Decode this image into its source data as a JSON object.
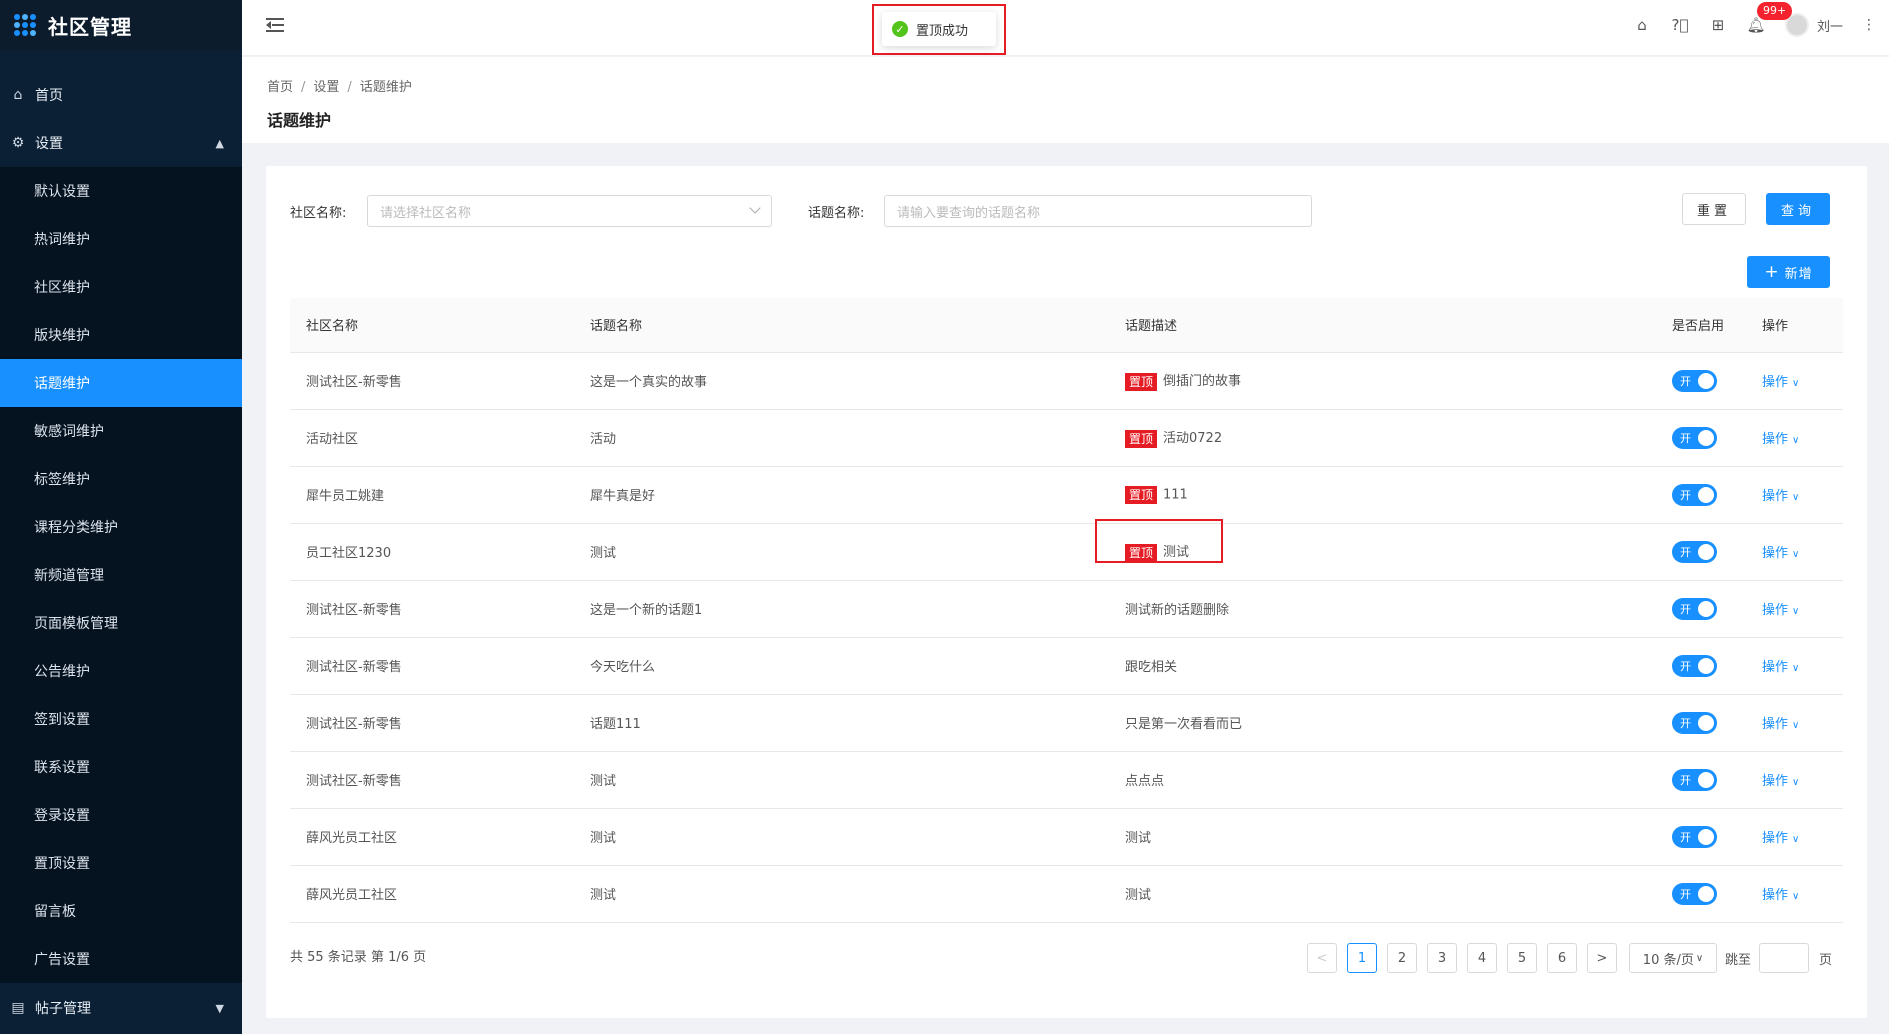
{
  "app": {
    "title": "社区管理"
  },
  "sidebar": {
    "home": "首页",
    "settings": "设置",
    "settings_items": [
      "默认设置",
      "热词维护",
      "社区维护",
      "版块维护",
      "话题维护",
      "敏感词维护",
      "标签维护",
      "课程分类维护",
      "新频道管理",
      "页面模板管理",
      "公告维护",
      "签到设置",
      "联系设置",
      "登录设置",
      "置顶设置",
      "留言板",
      "广告设置"
    ],
    "active_item": "话题维护",
    "posts": "帖子管理"
  },
  "header": {
    "toast": "置顶成功",
    "badge": "99+",
    "user_name": "刘一"
  },
  "breadcrumb": [
    "首页",
    "设置",
    "话题维护"
  ],
  "page_title": "话题维护",
  "filters": {
    "community_label": "社区名称:",
    "community_placeholder": "请选择社区名称",
    "topic_label": "话题名称:",
    "topic_placeholder": "请输入要查询的话题名称"
  },
  "buttons": {
    "reset": "重置",
    "query": "查询",
    "add": "新增"
  },
  "table": {
    "headers": [
      "社区名称",
      "话题名称",
      "话题描述",
      "是否启用",
      "操作"
    ],
    "pin_label": "置顶",
    "switch_label": "开",
    "action_label": "操作",
    "rows": [
      {
        "community": "测试社区-新零售",
        "topic": "这是一个真实的故事",
        "pinned": true,
        "desc": "倒插门的故事"
      },
      {
        "community": "活动社区",
        "topic": "活动",
        "pinned": true,
        "desc": "活动0722"
      },
      {
        "community": "犀牛员工姚建",
        "topic": "犀牛真是好",
        "pinned": true,
        "desc": "111"
      },
      {
        "community": "员工社区1230",
        "topic": "测试",
        "pinned": true,
        "desc": "测试"
      },
      {
        "community": "测试社区-新零售",
        "topic": "这是一个新的话题1",
        "pinned": false,
        "desc": "测试新的话题删除"
      },
      {
        "community": "测试社区-新零售",
        "topic": "今天吃什么",
        "pinned": false,
        "desc": "跟吃相关"
      },
      {
        "community": "测试社区-新零售",
        "topic": "话题111",
        "pinned": false,
        "desc": "只是第一次看看而已"
      },
      {
        "community": "测试社区-新零售",
        "topic": "测试",
        "pinned": false,
        "desc": "点点点"
      },
      {
        "community": "薛风光员工社区",
        "topic": "测试",
        "pinned": false,
        "desc": "测试"
      },
      {
        "community": "薛风光员工社区",
        "topic": "测试",
        "pinned": false,
        "desc": "测试"
      }
    ]
  },
  "pagination": {
    "summary": "共 55 条记录 第 1/6 页",
    "prev": "<",
    "next": ">",
    "pages": [
      "1",
      "2",
      "3",
      "4",
      "5",
      "6"
    ],
    "current": "1",
    "page_size": "10 条/页",
    "jump_label": "跳至",
    "page_suffix": "页"
  },
  "colors": {
    "primary": "#1890ff",
    "pin": "#e51c23",
    "sidebar": "#0b2035"
  },
  "icons": {
    "home": "home-icon",
    "help": "help-icon",
    "apps": "apps-icon",
    "bell": "bell-icon",
    "more": "more-icon",
    "settings": "gear-icon",
    "posts": "list-icon"
  }
}
